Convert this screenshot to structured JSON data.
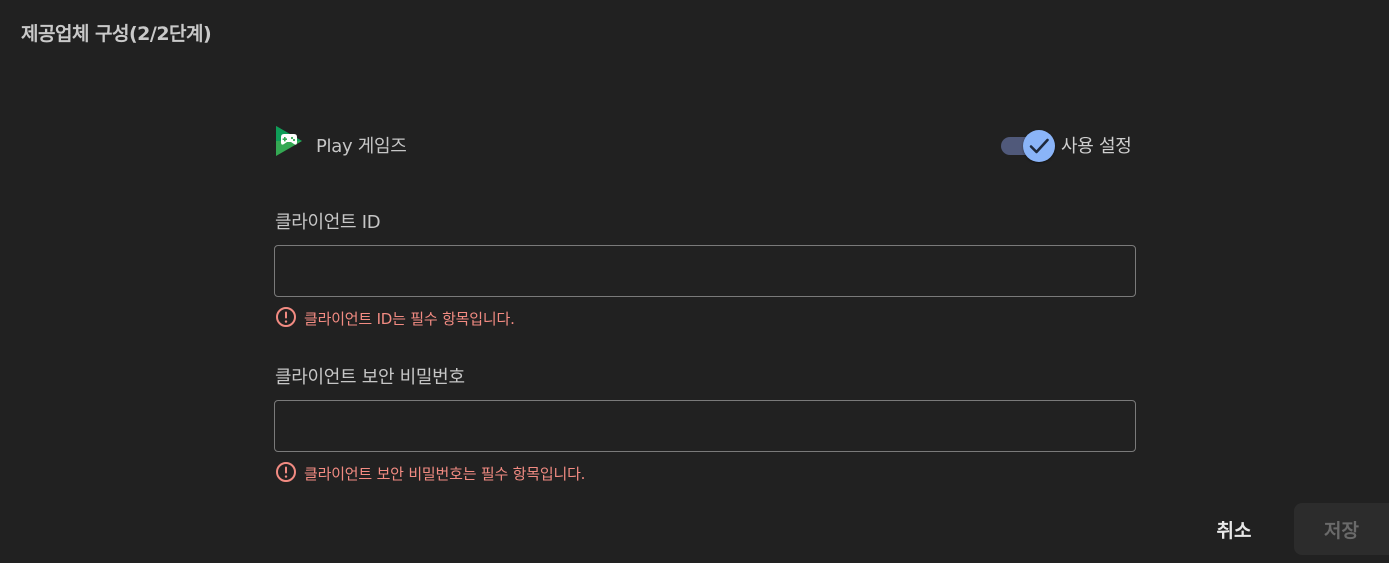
{
  "dialog": {
    "title": "제공업체 구성(2/2단계)"
  },
  "provider": {
    "name": "Play 게임즈",
    "logo_icon": "google-play-games-icon",
    "enable_label": "사용 설정",
    "enabled": true
  },
  "client_id": {
    "label": "클라이언트 ID",
    "value": "",
    "error": "클라이언트 ID는 필수 항목입니다."
  },
  "client_secret": {
    "label": "클라이언트 보안 비밀번호",
    "value": "",
    "error": "클라이언트 보안 비밀번호는 필수 항목입니다."
  },
  "actions": {
    "cancel_label": "취소",
    "save_label": "저장"
  },
  "colors": {
    "background": "#212121",
    "accent": "#8ab4f8",
    "error": "#f28b82"
  }
}
